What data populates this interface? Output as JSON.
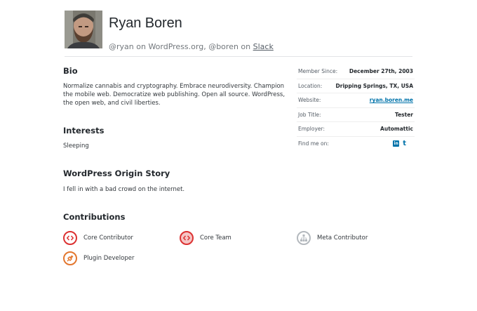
{
  "profile": {
    "name": "Ryan Boren",
    "handles_prefix": "@ryan on WordPress.org, @boren on ",
    "handles_link": "Slack"
  },
  "sections": {
    "bio": {
      "heading": "Bio",
      "text": "Normalize cannabis and cryptography. Embrace neurodiversity. Champion the mobile web. Democratize web publishing. Open all source. WordPress, the open web, and civil liberties."
    },
    "interests": {
      "heading": "Interests",
      "text": "Sleeping"
    },
    "origin": {
      "heading": "WordPress Origin Story",
      "text": "I fell in with a bad crowd on the internet."
    },
    "contributions": {
      "heading": "Contributions"
    }
  },
  "meta": [
    {
      "label": "Member Since:",
      "value": "December 27th, 2003"
    },
    {
      "label": "Location:",
      "value": "Dripping Springs, TX, USA"
    },
    {
      "label": "Website:",
      "value": "ryan.boren.me"
    },
    {
      "label": "Job Title:",
      "value": "Tester"
    },
    {
      "label": "Employer:",
      "value": "Automattic"
    },
    {
      "label": "Find me on:",
      "value": ""
    }
  ],
  "social": {
    "linkedin_glyph": "in",
    "tumblr_glyph": "t"
  },
  "badges": [
    {
      "label": "Core Contributor",
      "icon": "code-brackets-icon",
      "color": "#dc3232"
    },
    {
      "label": "Core Team",
      "icon": "code-brackets-icon",
      "color": "#dc3232"
    },
    {
      "label": "Meta Contributor",
      "icon": "sitemap-icon",
      "color": "#b4b9be"
    },
    {
      "label": "Plugin Developer",
      "icon": "plug-icon",
      "color": "#e3772f"
    }
  ],
  "colors": {
    "link": "#0073aa",
    "core": "#dc3232",
    "plugin": "#e3772f",
    "meta": "#b4b9be"
  }
}
